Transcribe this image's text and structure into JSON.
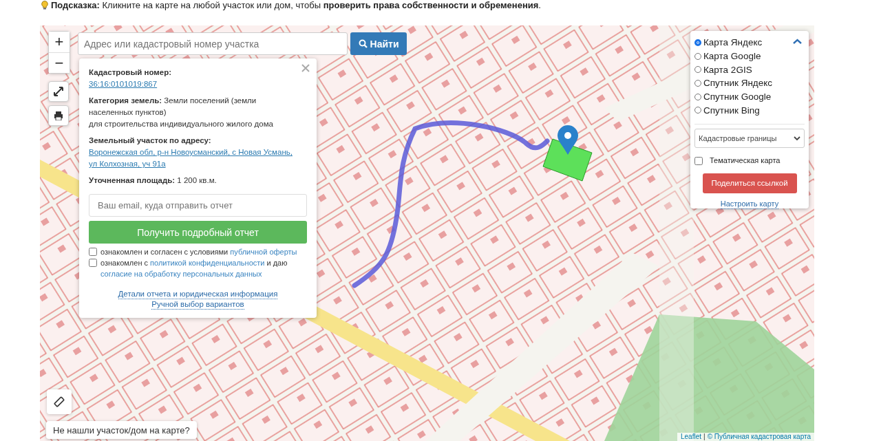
{
  "hint": "**Подсказка:** Кликните на карте на любой участок или дом, чтобы **проверить права собственности и обременения**.",
  "map": {
    "kind": "picture",
    "zoom_controls": [
      "+",
      "−"
    ],
    "search": {
      "placeholder": "Адрес или кадастровый номер участка",
      "button": "Найти"
    },
    "popup": {
      "fields": [
        {
          "label": "Кадастровый номер:",
          "kind": "link",
          "value": "36:16:0101019:867"
        },
        {
          "label": "Категория земель:",
          "kind": "text",
          "value": "Земли поселений (земли населенных пунктов)",
          "note": "для строительства индивидуального жилого дома"
        },
        {
          "label": "Земельный участок по адресу:",
          "kind": "link",
          "value": "Воронежская обл, р-н Новоусманский, с Новая Усмань, ул Колхозная, уч 91а"
        },
        {
          "label": "Уточненная площадь:",
          "kind": "text",
          "value": "1 200 кв.м."
        }
      ],
      "email": {
        "placeholder": "Ваш email, куда отправить отчет"
      },
      "submit": "Получить подробный отчет",
      "consents": [
        {
          "checked": false,
          "parts": [
            {
              "text": "ознакомлен и согласен с условиями ",
              "kind": "text"
            },
            {
              "text": "публичной оферты",
              "kind": "link"
            }
          ]
        },
        {
          "checked": false,
          "parts": [
            {
              "text": "ознакомлен с ",
              "kind": "text"
            },
            {
              "text": "политикой конфиденциальности",
              "kind": "link"
            },
            {
              "text": " и даю ",
              "kind": "text"
            },
            {
              "text": "согласие на обработку персональных данных",
              "kind": "link"
            }
          ]
        }
      ],
      "links": [
        "Детали отчета и юридическая информация",
        "Ручной выбор вариантов"
      ]
    },
    "layers": {
      "expanded": true,
      "options": [
        {
          "label": "Карта Яндекс",
          "selected": true
        },
        {
          "label": "Карта Google",
          "selected": false
        },
        {
          "label": "Карта 2GIS",
          "selected": false
        },
        {
          "label": "Спутник Яндекс",
          "selected": false
        },
        {
          "label": "Спутник Google",
          "selected": false
        },
        {
          "label": "Спутник Bing",
          "selected": false
        }
      ],
      "overlay_select": "Кадастровые границы",
      "thematic": {
        "label": "Тематическая карта",
        "checked": false
      },
      "share_button": "Поделиться ссылкой",
      "settings_link": "Настроить карту"
    },
    "not_found_button": "Не нашли участок/дом на карте?",
    "attribution": {
      "library": "Leaflet",
      "separator": "|",
      "source": "© Публичная кадастровая карта"
    }
  }
}
